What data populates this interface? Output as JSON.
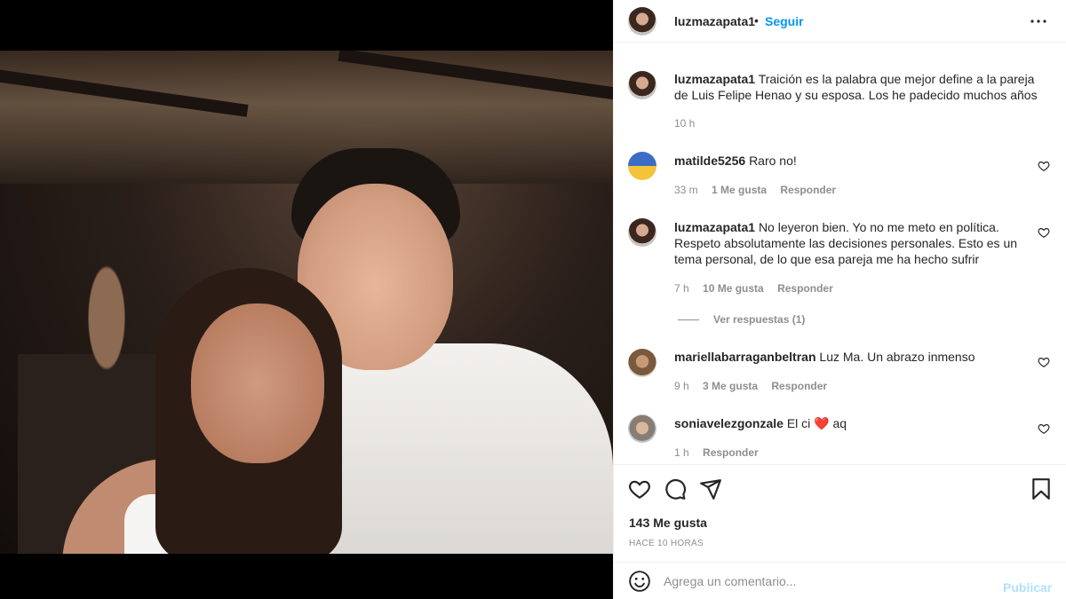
{
  "post": {
    "username": "luzmazapata1",
    "separator": "•",
    "follow_label": "Seguir",
    "caption_user": "luzmazapata1",
    "caption": "Traición es la palabra que mejor define a la pareja de Luis Felipe Henao y su esposa. Los he padecido muchos años",
    "caption_time": "10 h",
    "likes": "143 Me gusta",
    "posted": "HACE 10 HORAS"
  },
  "comments": [
    {
      "user": "matilde5256",
      "text": "Raro no!",
      "time": "33 m",
      "likes": "1 Me gusta",
      "reply": "Responder"
    },
    {
      "user": "luzmazapata1",
      "text": "No leyeron bien. Yo no me meto en política. Respeto absolutamente las decisiones personales. Esto es un tema personal, de lo que esa pareja me ha hecho sufrir",
      "time": "7 h",
      "likes": "10 Me gusta",
      "reply": "Responder",
      "view_replies": "Ver respuestas (1)"
    },
    {
      "user": "mariellabarraganbeltran",
      "text": "Luz Ma. Un abrazo inmenso",
      "time": "9 h",
      "likes": "3 Me gusta",
      "reply": "Responder"
    },
    {
      "user": "soniavelezgonzale",
      "text_before": "El ci",
      "text_emoji": "❤️",
      "text_after": "aq",
      "time": "1 h",
      "reply": "Responder"
    }
  ],
  "composer": {
    "placeholder": "Agrega un comentario...",
    "publish_label": "Publicar"
  },
  "icons": [
    "more-icon",
    "heart-icon",
    "comment-icon",
    "share-icon",
    "save-icon",
    "emoji-icon"
  ],
  "colors": {
    "link": "#0095f6",
    "publish_disabled": "#b2dffc",
    "muted": "#8e8e8e",
    "heart_red": "#ed4956"
  }
}
